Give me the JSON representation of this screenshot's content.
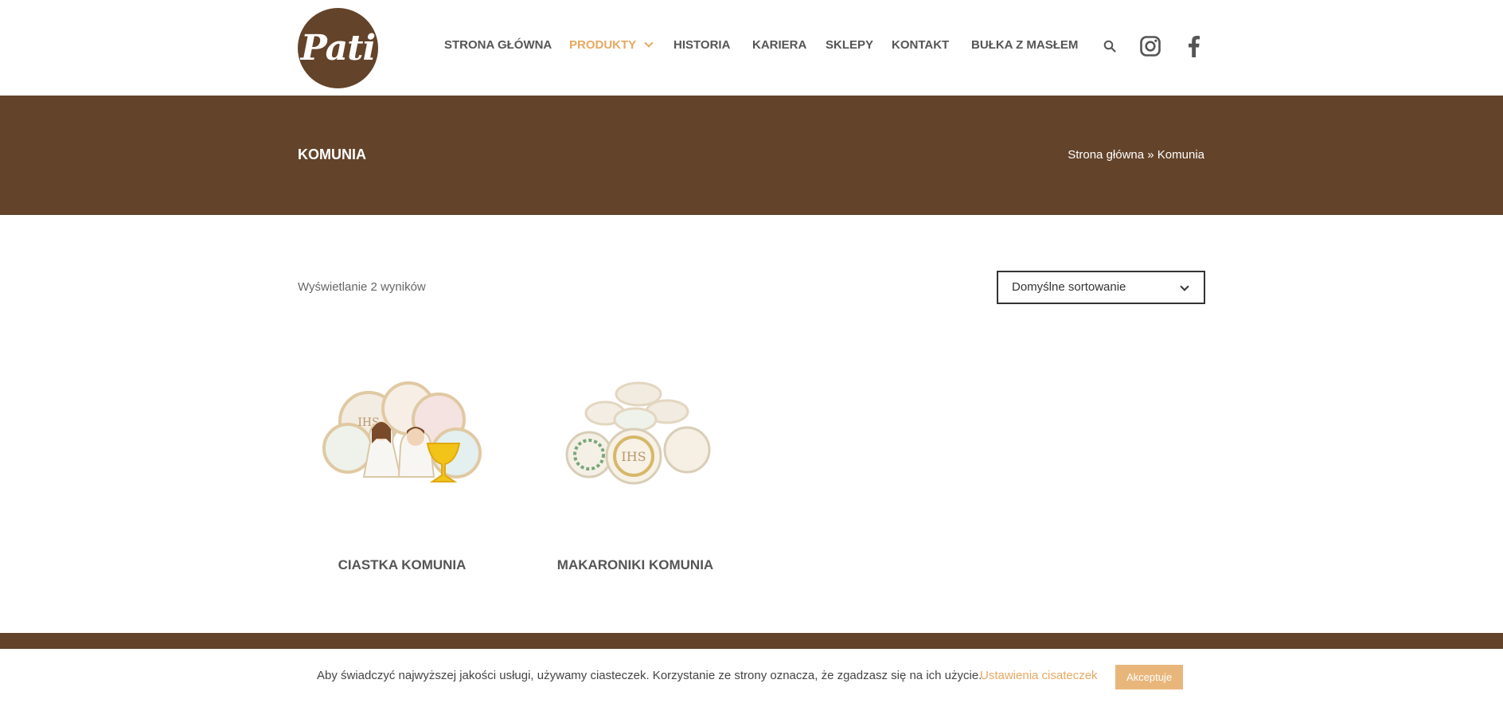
{
  "header": {
    "logo_text": "Pati",
    "nav": [
      {
        "label": "STRONA GŁÓWNA"
      },
      {
        "label": "PRODUKTY",
        "active": true
      },
      {
        "label": "HISTORIA"
      },
      {
        "label": "KARIERA"
      },
      {
        "label": "SKLEPY"
      },
      {
        "label": "KONTAKT"
      },
      {
        "label": "BUŁKA Z MASŁEM"
      }
    ],
    "icons": [
      "search-icon",
      "instagram-icon",
      "facebook-icon"
    ]
  },
  "banner": {
    "title": "KOMUNIA",
    "breadcrumb_home": "Strona główna",
    "breadcrumb_sep": "»",
    "breadcrumb_current": "Komunia"
  },
  "shop": {
    "results_count": "Wyświetlanie 2 wyników",
    "sort_selected": "Domyślne sortowanie"
  },
  "products": [
    {
      "name": "CIASTKA KOMUNIA"
    },
    {
      "name": "MAKARONIKI KOMUNIA"
    }
  ],
  "cookie": {
    "text": "Aby świadczyć najwyższej jakości usługi, używamy ciasteczek. Korzystanie ze strony oznacza, że zgadzasz się na ich użycie.",
    "settings_label": "Ustawienia cisateczek",
    "accept_label": "Akceptuje"
  },
  "colors": {
    "brand_brown": "#63432a",
    "accent": "#e8a861",
    "accept_bg": "#e8b67b"
  }
}
